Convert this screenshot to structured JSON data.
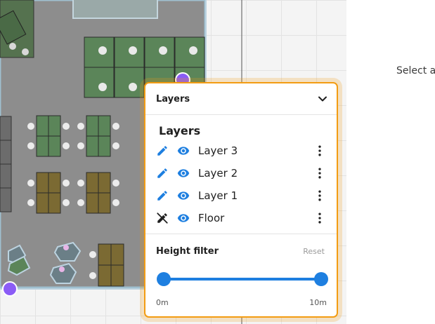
{
  "colors": {
    "accent": "#1e7fe0",
    "highlight_border": "#f39c12",
    "desk_green": "#5b8559",
    "desk_brown": "#7b6a33",
    "floor_gray": "#8d8d8d",
    "marker_purple": "#8b5cf6"
  },
  "right_panel": {
    "hint": "Select a"
  },
  "layers_panel": {
    "title": "Layers",
    "collapse_icon": "chevron-down-icon",
    "heading": "Layers",
    "layers": [
      {
        "name": "Layer 3",
        "edit_icon": "pencil-icon",
        "visibility_icon": "eye-icon",
        "menu_icon": "more-vert-icon"
      },
      {
        "name": "Layer 2",
        "edit_icon": "pencil-icon",
        "visibility_icon": "eye-icon",
        "menu_icon": "more-vert-icon"
      },
      {
        "name": "Layer 1",
        "edit_icon": "pencil-icon",
        "visibility_icon": "eye-icon",
        "menu_icon": "more-vert-icon"
      },
      {
        "name": "Floor",
        "edit_icon": "pencil-off-icon",
        "visibility_icon": "eye-icon",
        "menu_icon": "more-vert-icon"
      }
    ],
    "height_filter": {
      "label": "Height filter",
      "reset_label": "Reset",
      "min_label": "0m",
      "max_label": "10m",
      "range": [
        0,
        1
      ]
    }
  }
}
